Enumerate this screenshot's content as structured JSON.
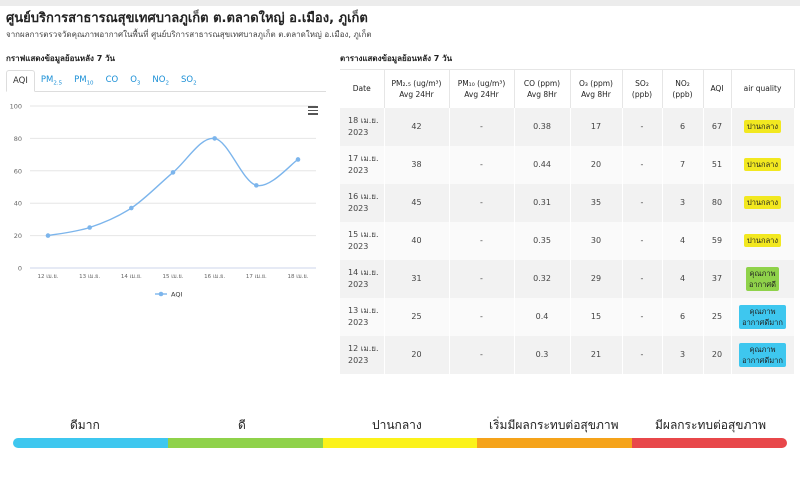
{
  "header": {
    "title": "ศูนย์บริการสาธารณสุขเทศบาลภูเก็ต ต.ตลาดใหญ่ อ.เมือง, ภูเก็ต",
    "subtitle": "จากผลการตรวจวัดคุณภาพอากาศในพื้นที่ ศูนย์บริการสาธารณสุขเทศบาลภูเก็ต ต.ตลาดใหญ่ อ.เมือง, ภูเก็ต"
  },
  "graph_section": {
    "title": "กราฟแสดงข้อมูลย้อนหลัง 7 วัน"
  },
  "table_section": {
    "title": "ตารางแสดงข้อมูลย้อนหลัง 7 วัน"
  },
  "tabs": [
    {
      "main": "AQI",
      "sub": ""
    },
    {
      "main": "PM",
      "sub": "2.5"
    },
    {
      "main": "PM",
      "sub": "10"
    },
    {
      "main": "CO",
      "sub": ""
    },
    {
      "main": "O",
      "sub": "3"
    },
    {
      "main": "NO",
      "sub": "2"
    },
    {
      "main": "SO",
      "sub": "2"
    }
  ],
  "chart_data": {
    "type": "line",
    "x": [
      "12 เม.ย.",
      "13 เม.ย.",
      "14 เม.ย.",
      "15 เม.ย.",
      "16 เม.ย.",
      "17 เม.ย.",
      "18 เม.ย."
    ],
    "series": [
      {
        "name": "AQI",
        "values": [
          20,
          25,
          37,
          59,
          80,
          51,
          67
        ],
        "color": "#7cb5ec"
      }
    ],
    "ylim": [
      0,
      100
    ],
    "yticks": [
      0,
      20,
      40,
      60,
      80,
      100
    ],
    "grid": true,
    "legend": "bottom-center"
  },
  "table": {
    "headers": [
      {
        "l1": "Date",
        "l2": ""
      },
      {
        "l1": "PM₂.₅ (ug/m³)",
        "l2": "Avg 24Hr"
      },
      {
        "l1": "PM₁₀ (ug/m³)",
        "l2": "Avg 24Hr"
      },
      {
        "l1": "CO (ppm)",
        "l2": "Avg 8Hr"
      },
      {
        "l1": "O₃ (ppm)",
        "l2": "Avg 8Hr"
      },
      {
        "l1": "SO₂",
        "l2": "(ppb)"
      },
      {
        "l1": "NO₂",
        "l2": "(ppb)"
      },
      {
        "l1": "AQI",
        "l2": ""
      },
      {
        "l1": "air quality",
        "l2": ""
      }
    ],
    "rows": [
      {
        "date1": "18 เม.ย.",
        "date2": "2023",
        "pm25": "42",
        "pm10": "-",
        "co": "0.38",
        "o3": "17",
        "so2": "-",
        "no2": "6",
        "aqi": "67",
        "q1": "ปานกลาง",
        "q2": "",
        "qcolor": "#f2e820"
      },
      {
        "date1": "17 เม.ย.",
        "date2": "2023",
        "pm25": "38",
        "pm10": "-",
        "co": "0.44",
        "o3": "20",
        "so2": "-",
        "no2": "7",
        "aqi": "51",
        "q1": "ปานกลาง",
        "q2": "",
        "qcolor": "#f2e820"
      },
      {
        "date1": "16 เม.ย.",
        "date2": "2023",
        "pm25": "45",
        "pm10": "-",
        "co": "0.31",
        "o3": "35",
        "so2": "-",
        "no2": "3",
        "aqi": "80",
        "q1": "ปานกลาง",
        "q2": "",
        "qcolor": "#f2e820"
      },
      {
        "date1": "15 เม.ย.",
        "date2": "2023",
        "pm25": "40",
        "pm10": "-",
        "co": "0.35",
        "o3": "30",
        "so2": "-",
        "no2": "4",
        "aqi": "59",
        "q1": "ปานกลาง",
        "q2": "",
        "qcolor": "#f2e820"
      },
      {
        "date1": "14 เม.ย.",
        "date2": "2023",
        "pm25": "31",
        "pm10": "-",
        "co": "0.32",
        "o3": "29",
        "so2": "-",
        "no2": "4",
        "aqi": "37",
        "q1": "คุณภาพ",
        "q2": "อากาศดี",
        "qcolor": "#8fd24a"
      },
      {
        "date1": "13 เม.ย.",
        "date2": "2023",
        "pm25": "25",
        "pm10": "-",
        "co": "0.4",
        "o3": "15",
        "so2": "-",
        "no2": "6",
        "aqi": "25",
        "q1": "คุณภาพ",
        "q2": "อากาศดีมาก",
        "qcolor": "#3ec7ef"
      },
      {
        "date1": "12 เม.ย.",
        "date2": "2023",
        "pm25": "20",
        "pm10": "-",
        "co": "0.3",
        "o3": "21",
        "so2": "-",
        "no2": "3",
        "aqi": "20",
        "q1": "คุณภาพ",
        "q2": "อากาศดีมาก",
        "qcolor": "#3ec7ef"
      }
    ]
  },
  "scale": {
    "labels": [
      "ดีมาก",
      "ดี",
      "ปานกลาง",
      "เริ่มมีผลกระทบต่อสุขภาพ",
      "มีผลกระทบต่อสุขภาพ"
    ],
    "colors": [
      "#3ec7ef",
      "#8fd24a",
      "#fbf21a",
      "#f5a31a",
      "#e8474a"
    ]
  }
}
